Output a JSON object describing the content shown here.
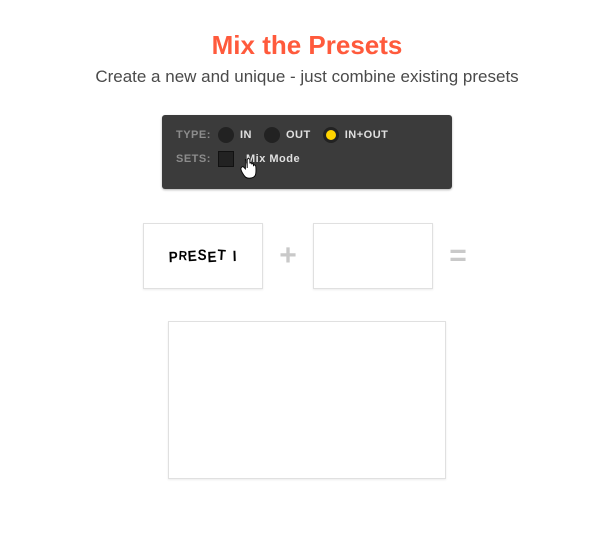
{
  "header": {
    "title": "Mix the Presets",
    "subtitle": "Create a new and unique - just combine existing presets"
  },
  "panel": {
    "type_label": "TYPE:",
    "sets_label": "SETS:",
    "options": {
      "in": "IN",
      "out": "OUT",
      "inout": "IN+OUT"
    },
    "mix_mode_label": "Mix Mode"
  },
  "combo": {
    "preset1_text": "PRESET I",
    "plus": "+",
    "equals": "="
  },
  "colors": {
    "accent": "#ff5a3c",
    "radio_selected": "#ffd400",
    "panel_bg": "#3b3b3b"
  }
}
